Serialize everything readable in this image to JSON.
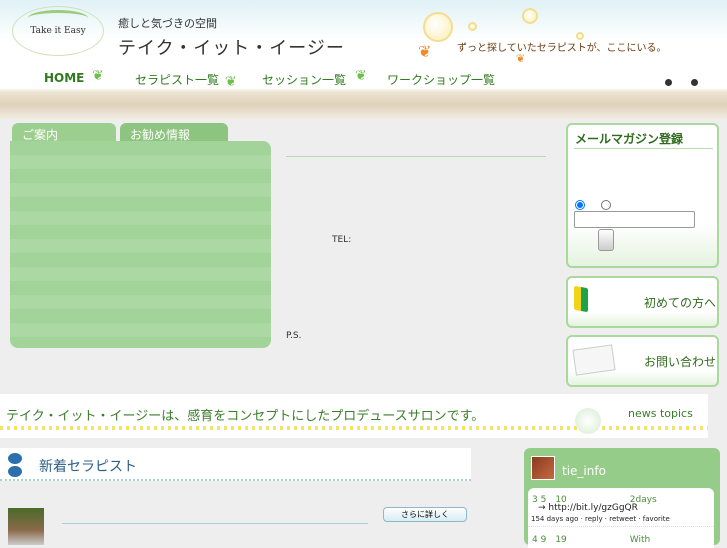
{
  "header": {
    "logo_text": "Take it Easy",
    "tagline": "癒しと気づきの空間",
    "site_title": "テイク・イット・イージー",
    "catchphrase": "ずっと探していたセラピストが、ここにいる。"
  },
  "nav": [
    {
      "label": "HOME"
    },
    {
      "label": "セラピスト一覧"
    },
    {
      "label": "セッション一覧"
    },
    {
      "label": "ワークショップ一覧"
    }
  ],
  "tabs": [
    {
      "label": "ご案内"
    },
    {
      "label": "お勧め情報"
    }
  ],
  "info": {
    "tel_label": "TEL:",
    "ps_label": "P.S."
  },
  "mailmag": {
    "title": "メールマガジン登録",
    "email_value": "",
    "submit_label": ""
  },
  "side_buttons": [
    {
      "label": "初めての方へ"
    },
    {
      "label": "お問い合わせ"
    }
  ],
  "banner": {
    "text": "テイク・イット・イージーは、感育をコンセプトにしたプロデュースサロンです。",
    "news_label": "news topics"
  },
  "new_therapists": {
    "title": "新着セラピスト",
    "more_label": "さらに詳しく"
  },
  "twitter": {
    "username": "tie_info",
    "tweets": [
      {
        "line1": "3 5　10　　　　　　　2days",
        "link": "→ http://bit.ly/gzGgQR",
        "meta": "154 days ago · reply · retweet · favorite"
      },
      {
        "line1": "4 9　19　　　　　　　With"
      }
    ]
  }
}
